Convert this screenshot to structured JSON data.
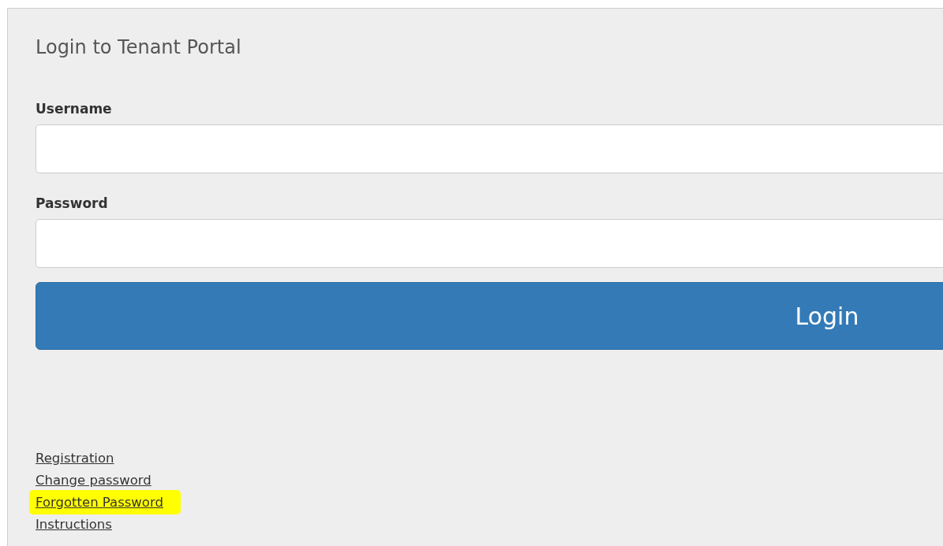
{
  "title": "Login to Tenant Portal",
  "fields": [
    {
      "label": "Username"
    },
    {
      "label": "Password"
    }
  ],
  "login_button": "Login",
  "links": [
    {
      "label": "Registration",
      "highlighted": false
    },
    {
      "label": "Change password",
      "highlighted": false
    },
    {
      "label": "Forgotten Password",
      "highlighted": true
    },
    {
      "label": "Instructions",
      "highlighted": false
    }
  ]
}
